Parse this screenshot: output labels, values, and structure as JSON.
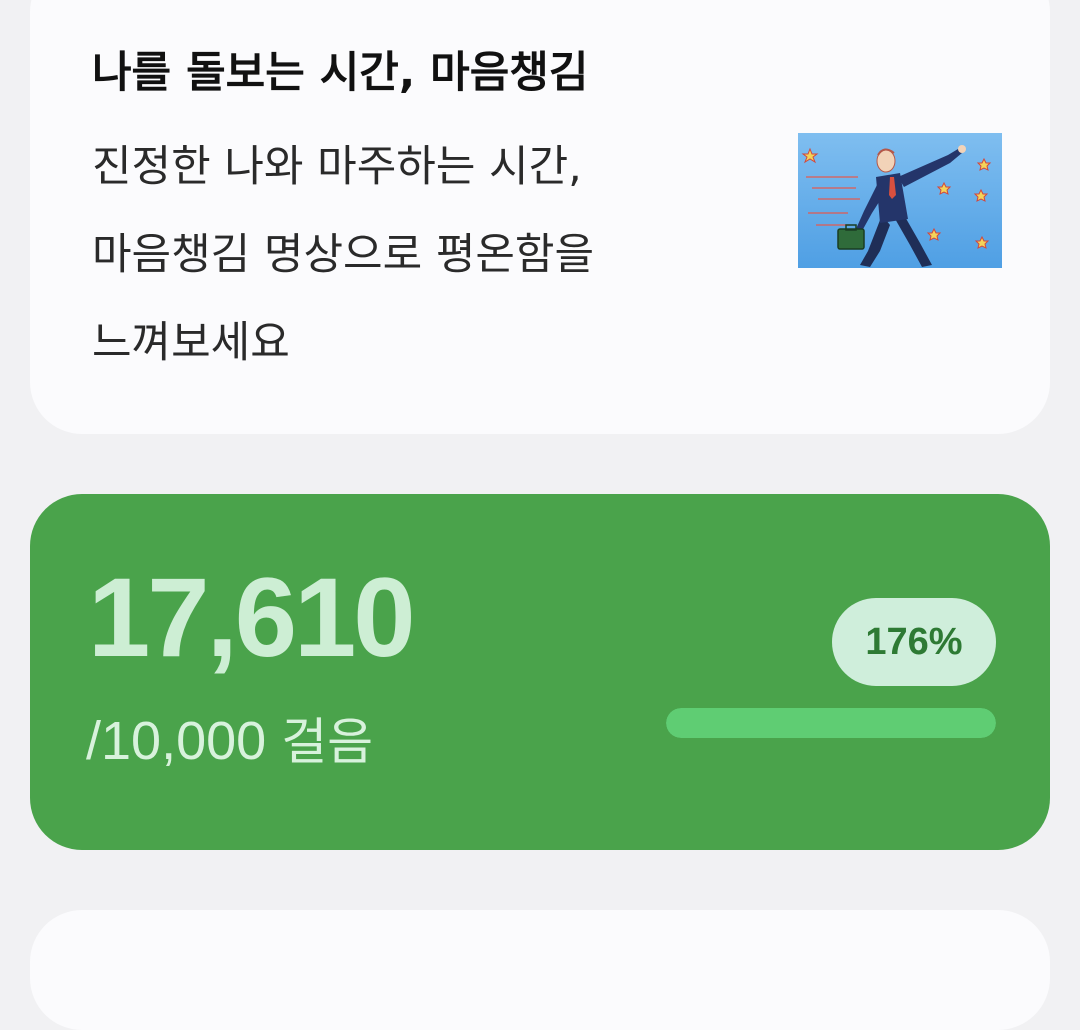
{
  "mindfulness": {
    "title": "나를 돌보는 시간, 마음챙김",
    "description_lines": [
      "진정한 나와 마주하는 시간,",
      "마음챙김 명상으로 평온함을",
      "느껴보세요"
    ],
    "thumbnail_icon": "walking-businessman-illustration"
  },
  "steps": {
    "count": "17,610",
    "goal": "/10,000",
    "unit": "걸음",
    "percent_label": "176%",
    "progress_fraction": 1.0,
    "card_color": "#4aa34b",
    "fill_color": "#5fcd73"
  }
}
